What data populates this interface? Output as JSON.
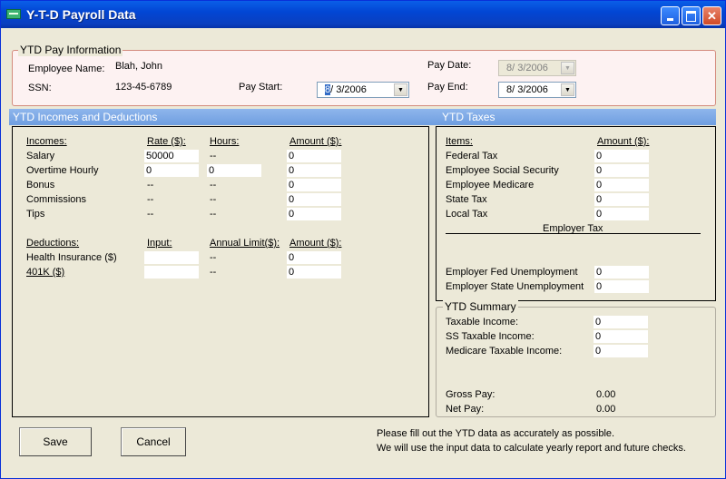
{
  "window": {
    "title": "Y-T-D Payroll Data"
  },
  "pay_info": {
    "legend": "YTD Pay Information",
    "employee_name_label": "Employee Name:",
    "employee_name": "Blah, John",
    "ssn_label": "SSN:",
    "ssn": "123-45-6789",
    "pay_start_label": "Pay Start:",
    "pay_start_prefix": "8",
    "pay_start_rest": "/  3/2006",
    "pay_date_label": "Pay Date:",
    "pay_date": "8/  3/2006",
    "pay_end_label": "Pay End:",
    "pay_end": "8/  3/2006"
  },
  "incomes_panel": {
    "title": "YTD Incomes and Deductions",
    "headers": {
      "incomes": "Incomes:",
      "rate": "Rate ($):",
      "hours": "Hours:",
      "amount": "Amount ($):"
    },
    "rows": [
      {
        "label": "Salary",
        "rate": "50000",
        "hours": "--",
        "amount": "0"
      },
      {
        "label": "Overtime Hourly",
        "rate": "0",
        "hours": "0",
        "amount": "0"
      },
      {
        "label": "Bonus",
        "rate": "--",
        "hours": "--",
        "amount": "0"
      },
      {
        "label": "Commissions",
        "rate": "--",
        "hours": "--",
        "amount": "0"
      },
      {
        "label": "Tips",
        "rate": "--",
        "hours": "--",
        "amount": "0"
      }
    ],
    "deduction_headers": {
      "deductions": "Deductions:",
      "input": "Input:",
      "annual_limit": "Annual Limit($):",
      "amount": "Amount ($):"
    },
    "deductions": [
      {
        "label": "Health Insurance  ($)",
        "input": "",
        "limit": "--",
        "amount": "0"
      },
      {
        "label": "401K  ($)",
        "input": "",
        "limit": "--",
        "amount": "0"
      }
    ]
  },
  "taxes_panel": {
    "title": "YTD Taxes",
    "headers": {
      "items": "Items:",
      "amount": "Amount ($):"
    },
    "rows": [
      {
        "label": "Federal Tax",
        "amount": "0"
      },
      {
        "label": "Employee Social Security",
        "amount": "0"
      },
      {
        "label": "Employee Medicare",
        "amount": "0"
      },
      {
        "label": "State Tax",
        "amount": "0"
      },
      {
        "label": "Local Tax",
        "amount": "0"
      }
    ],
    "employer_tax_label": "Employer Tax",
    "employer_rows": [
      {
        "label": "Employer Fed Unemployment",
        "amount": "0"
      },
      {
        "label": "Employer State Unemployment",
        "amount": "0"
      }
    ]
  },
  "summary": {
    "legend": "YTD Summary",
    "rows": [
      {
        "label": "Taxable Income:",
        "value": "0"
      },
      {
        "label": "SS Taxable Income:",
        "value": "0"
      },
      {
        "label": "Medicare Taxable Income:",
        "value": "0"
      }
    ],
    "gross_pay_label": "Gross Pay:",
    "gross_pay": "0.00",
    "net_pay_label": "Net Pay:",
    "net_pay": "0.00"
  },
  "buttons": {
    "save": "Save",
    "cancel": "Cancel"
  },
  "message": {
    "line1": "Please fill out the YTD data as accurately as possible.",
    "line2": "We will use the input data to calculate yearly report and future checks."
  }
}
